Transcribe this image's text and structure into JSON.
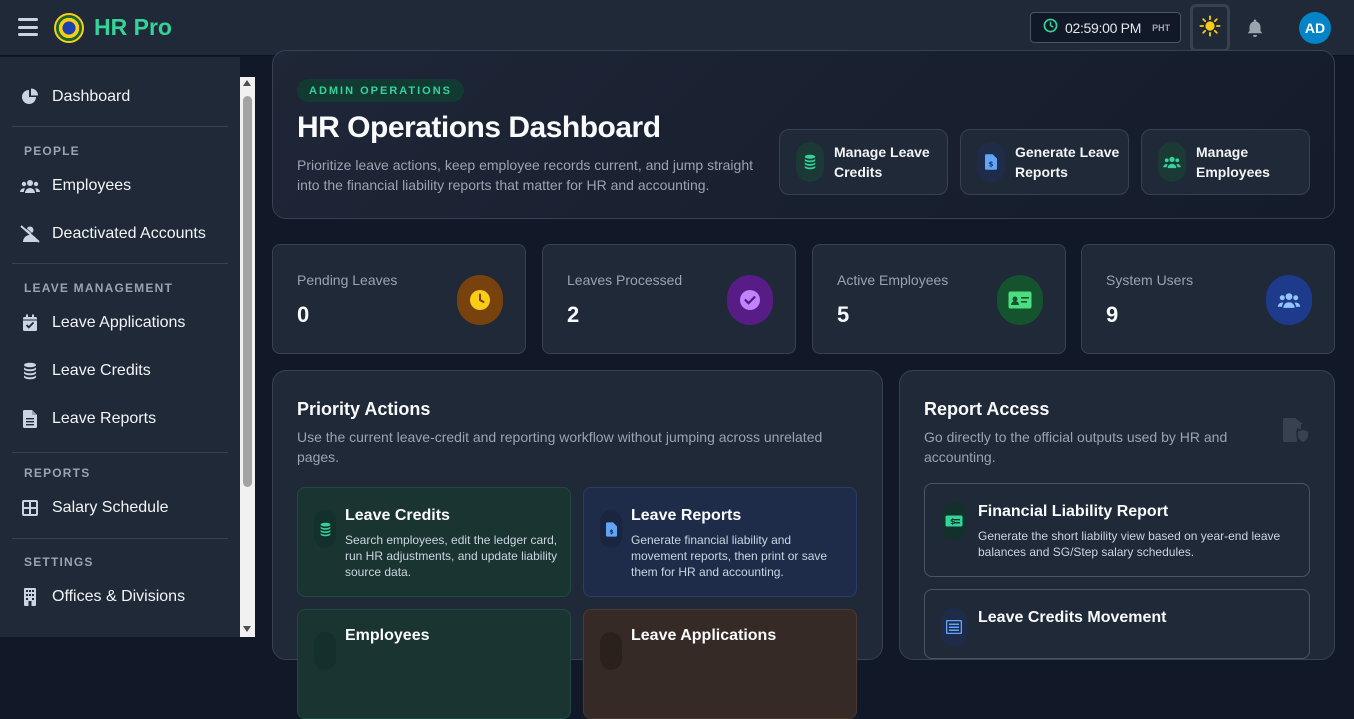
{
  "app": {
    "brand": "HR Pro"
  },
  "topbar": {
    "time": "02:59:00 PM",
    "timezone": "PHT",
    "avatar_initials": "AD"
  },
  "sidebar": {
    "dashboard": "Dashboard",
    "sections": [
      {
        "title": "PEOPLE",
        "items": [
          "Employees",
          "Deactivated Accounts"
        ]
      },
      {
        "title": "LEAVE MANAGEMENT",
        "items": [
          "Leave Applications",
          "Leave Credits",
          "Leave Reports"
        ]
      },
      {
        "title": "REPORTS",
        "items": [
          "Salary Schedule"
        ]
      },
      {
        "title": "SETTINGS",
        "items": [
          "Offices & Divisions"
        ]
      }
    ]
  },
  "hero": {
    "chip": "ADMIN OPERATIONS",
    "title": "HR Operations Dashboard",
    "description": "Prioritize leave actions, keep employee records current, and jump straight into the financial liability reports that matter for HR and accounting.",
    "quick_actions": [
      {
        "label": "Manage Leave Credits",
        "icon": "coins-icon"
      },
      {
        "label": "Generate Leave Reports",
        "icon": "file-invoice-icon"
      },
      {
        "label": "Manage Employees",
        "icon": "users-icon"
      }
    ]
  },
  "stats": [
    {
      "label": "Pending Leaves",
      "value": "0",
      "icon": "clock-icon",
      "color": "#f59e0b"
    },
    {
      "label": "Leaves Processed",
      "value": "2",
      "icon": "check-circle-icon",
      "color": "#a855f7"
    },
    {
      "label": "Active Employees",
      "value": "5",
      "icon": "id-card-icon",
      "color": "#22c55e"
    },
    {
      "label": "System Users",
      "value": "9",
      "icon": "users-icon",
      "color": "#3b82f6"
    }
  ],
  "priority": {
    "title": "Priority Actions",
    "description": "Use the current leave-credit and reporting workflow without jumping across unrelated pages.",
    "actions": [
      {
        "title": "Leave Credits",
        "description": "Search employees, edit the ledger card, run HR adjustments, and update liability source data."
      },
      {
        "title": "Leave Reports",
        "description": "Generate financial liability and movement reports, then print or save them for HR and accounting."
      },
      {
        "title": "Employees",
        "description": ""
      },
      {
        "title": "Leave Applications",
        "description": ""
      }
    ]
  },
  "reports": {
    "title": "Report Access",
    "description": "Go directly to the official outputs used by HR and accounting.",
    "items": [
      {
        "title": "Financial Liability Report",
        "description": "Generate the short liability view based on year-end leave balances and SG/Step salary schedules."
      },
      {
        "title": "Leave Credits Movement",
        "description": ""
      }
    ]
  }
}
